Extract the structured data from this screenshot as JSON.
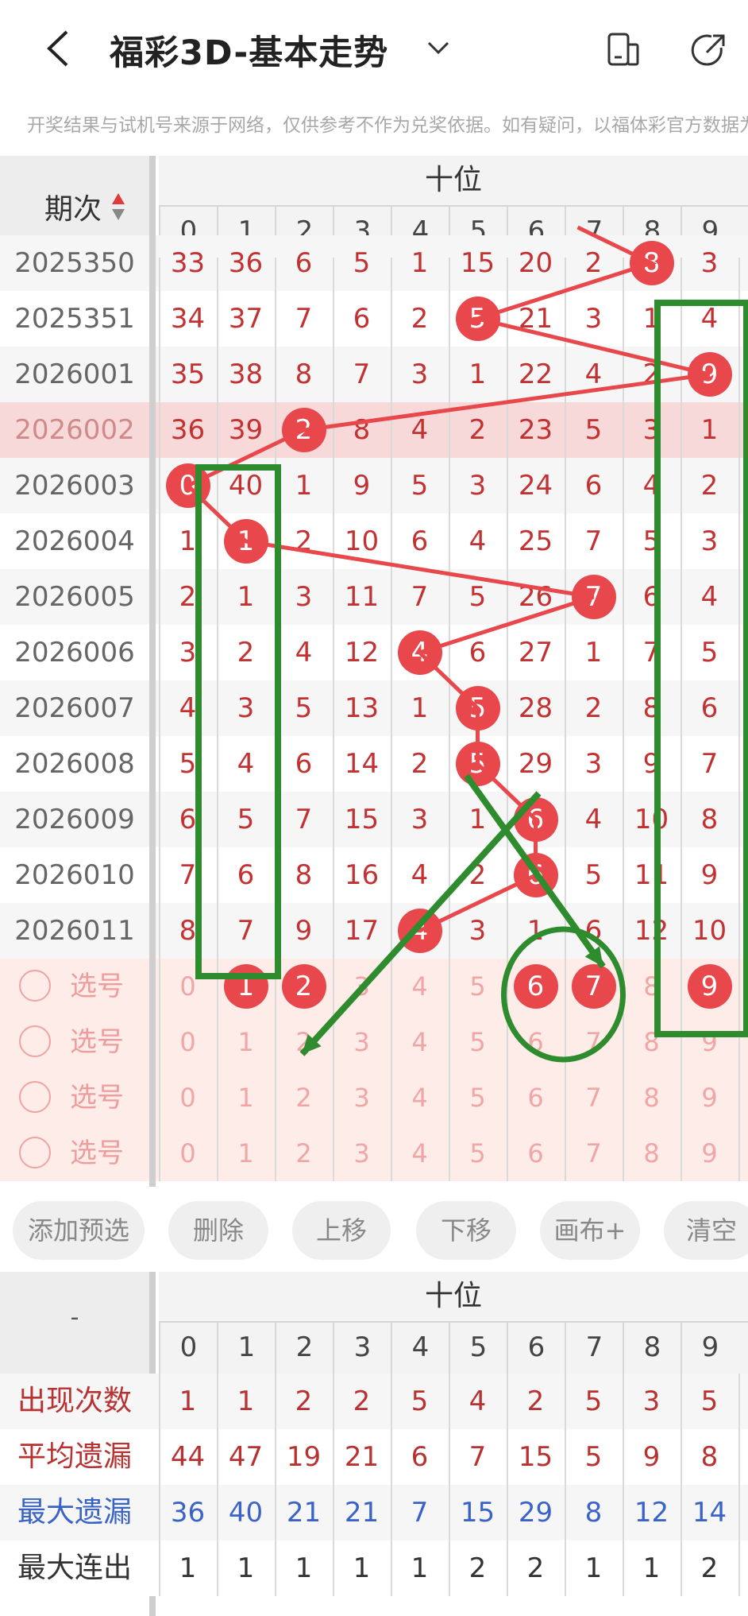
{
  "header": {
    "title": "福彩3D-基本走势",
    "icons": [
      "back-icon",
      "chevron-down-icon",
      "layout-toggle-icon",
      "share-icon"
    ]
  },
  "notice": "开奖结果与试机号来源于网络，仅供参考不作为兑奖依据。如有疑问，以福体彩官方数据为准",
  "table": {
    "period_label": "期次",
    "group_label": "十位",
    "digits": [
      "0",
      "1",
      "2",
      "3",
      "4",
      "5",
      "6",
      "7",
      "8",
      "9"
    ],
    "rows": [
      {
        "period": "2025350",
        "cells": [
          "33",
          "36",
          "6",
          "5",
          "1",
          "15",
          "20",
          "2",
          "8",
          "3"
        ],
        "hit": 8,
        "partial": true
      },
      {
        "period": "2025351",
        "cells": [
          "34",
          "37",
          "7",
          "6",
          "2",
          "5",
          "21",
          "3",
          "1",
          "4"
        ],
        "hit": 5
      },
      {
        "period": "2026001",
        "cells": [
          "35",
          "38",
          "8",
          "7",
          "3",
          "1",
          "22",
          "4",
          "2",
          "9"
        ],
        "hit": 9
      },
      {
        "period": "2026002",
        "cells": [
          "36",
          "39",
          "2",
          "8",
          "4",
          "2",
          "23",
          "5",
          "3",
          "1"
        ],
        "hit": 2,
        "highlight": true
      },
      {
        "period": "2026003",
        "cells": [
          "0",
          "40",
          "1",
          "9",
          "5",
          "3",
          "24",
          "6",
          "4",
          "2"
        ],
        "hit": 0
      },
      {
        "period": "2026004",
        "cells": [
          "1",
          "1",
          "2",
          "10",
          "6",
          "4",
          "25",
          "7",
          "5",
          "3"
        ],
        "hit": 1
      },
      {
        "period": "2026005",
        "cells": [
          "2",
          "1",
          "3",
          "11",
          "7",
          "5",
          "26",
          "7",
          "6",
          "4"
        ],
        "hit": 7
      },
      {
        "period": "2026006",
        "cells": [
          "3",
          "2",
          "4",
          "12",
          "4",
          "6",
          "27",
          "1",
          "7",
          "5"
        ],
        "hit": 4
      },
      {
        "period": "2026007",
        "cells": [
          "4",
          "3",
          "5",
          "13",
          "1",
          "5",
          "28",
          "2",
          "8",
          "6"
        ],
        "hit": 5
      },
      {
        "period": "2026008",
        "cells": [
          "5",
          "4",
          "6",
          "14",
          "2",
          "5",
          "29",
          "3",
          "9",
          "7"
        ],
        "hit": 5
      },
      {
        "period": "2026009",
        "cells": [
          "6",
          "5",
          "7",
          "15",
          "3",
          "1",
          "6",
          "4",
          "10",
          "8"
        ],
        "hit": 6
      },
      {
        "period": "2026010",
        "cells": [
          "7",
          "6",
          "8",
          "16",
          "4",
          "2",
          "6",
          "5",
          "11",
          "9"
        ],
        "hit": 6
      },
      {
        "period": "2026011",
        "cells": [
          "8",
          "7",
          "9",
          "17",
          "4",
          "3",
          "1",
          "6",
          "12",
          "10"
        ],
        "hit": 4
      }
    ],
    "pick_label": "选号",
    "picks": [
      {
        "cells": [
          "0",
          "1",
          "2",
          "3",
          "4",
          "5",
          "6",
          "7",
          "8",
          "9"
        ],
        "selected": [
          1,
          2,
          6,
          7,
          9
        ]
      },
      {
        "cells": [
          "0",
          "1",
          "2",
          "3",
          "4",
          "5",
          "6",
          "7",
          "8",
          "9"
        ],
        "selected": []
      },
      {
        "cells": [
          "0",
          "1",
          "2",
          "3",
          "4",
          "5",
          "6",
          "7",
          "8",
          "9"
        ],
        "selected": []
      },
      {
        "cells": [
          "0",
          "1",
          "2",
          "3",
          "4",
          "5",
          "6",
          "7",
          "8",
          "9"
        ],
        "selected": []
      }
    ]
  },
  "buttons": [
    "添加预选",
    "删除",
    "上移",
    "下移",
    "画布+",
    "清空"
  ],
  "stats": {
    "corner_label": "-",
    "group_label": "十位",
    "digits": [
      "0",
      "1",
      "2",
      "3",
      "4",
      "5",
      "6",
      "7",
      "8",
      "9"
    ],
    "rows": [
      {
        "label": "出现次数",
        "values": [
          "1",
          "1",
          "2",
          "2",
          "5",
          "4",
          "2",
          "5",
          "3",
          "5"
        ]
      },
      {
        "label": "平均遗漏",
        "values": [
          "44",
          "47",
          "19",
          "21",
          "6",
          "7",
          "15",
          "5",
          "9",
          "8"
        ]
      },
      {
        "label": "最大遗漏",
        "values": [
          "36",
          "40",
          "21",
          "21",
          "7",
          "15",
          "29",
          "8",
          "12",
          "14"
        ]
      },
      {
        "label": "最大连出",
        "values": [
          "1",
          "1",
          "1",
          "1",
          "1",
          "2",
          "2",
          "1",
          "1",
          "2"
        ]
      }
    ]
  },
  "colors": {
    "ball": "#e8484b",
    "annotation": "#2e8b2e",
    "stat_red": "#b83232",
    "stat_blue": "#3a63c8",
    "stat_dark": "#333333"
  }
}
